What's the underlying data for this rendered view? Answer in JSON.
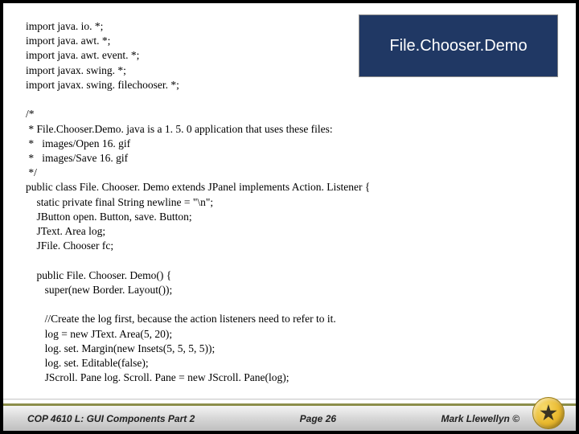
{
  "title": "File.Chooser.Demo",
  "code": "import java. io. *;\nimport java. awt. *;\nimport java. awt. event. *;\nimport javax. swing. *;\nimport javax. swing. filechooser. *;\n\n/*\n * File.Chooser.Demo. java is a 1. 5. 0 application that uses these files:\n *   images/Open 16. gif\n *   images/Save 16. gif\n */\npublic class File. Chooser. Demo extends JPanel implements Action. Listener {\n    static private final String newline = \"\\n\";\n    JButton open. Button, save. Button;\n    JText. Area log;\n    JFile. Chooser fc;\n\n    public File. Chooser. Demo() {\n       super(new Border. Layout());\n\n       //Create the log first, because the action listeners need to refer to it.\n       log = new JText. Area(5, 20);\n       log. set. Margin(new Insets(5, 5, 5, 5));\n       log. set. Editable(false);\n       JScroll. Pane log. Scroll. Pane = new JScroll. Pane(log);",
  "footer": {
    "left": "COP 4610 L: GUI Components Part 2",
    "center": "Page 26",
    "right": "Mark Llewellyn ©"
  }
}
